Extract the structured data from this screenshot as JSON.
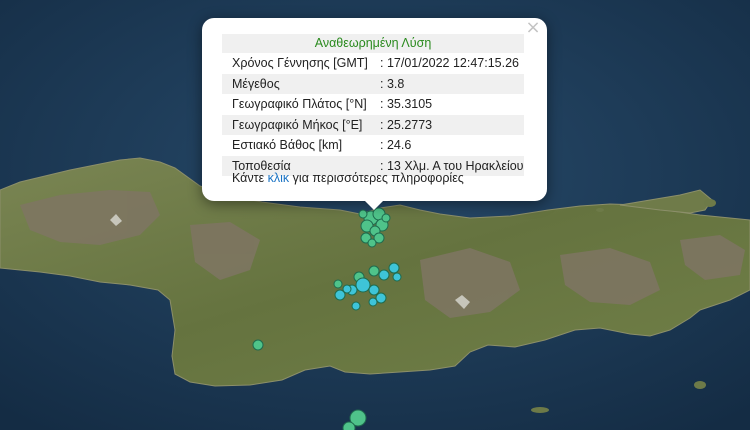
{
  "map": {
    "colors": {
      "sea": "#1a3550",
      "land": "#6d7a48",
      "mountain": "#7d7260",
      "quake_green": "#4fc38a",
      "quake_cyan": "#3ec4d8"
    }
  },
  "popup": {
    "title": "Αναθεωρημένη Λύση",
    "close_icon": "close-icon",
    "rows": [
      {
        "label": "Χρόνος Γέννησης [GMT]",
        "value": ": 17/01/2022 12:47:15.26"
      },
      {
        "label": "Μέγεθος",
        "value": ": 3.8"
      },
      {
        "label": "Γεωγραφικό Πλάτος [°N]",
        "value": ": 35.3105"
      },
      {
        "label": "Γεωγραφικό Μήκος [°E]",
        "value": ": 25.2773"
      },
      {
        "label": "Εστιακό Βάθος [km]",
        "value": ": 24.6"
      },
      {
        "label": "Τοποθεσία",
        "value": ": 13 Χλμ. Α του Ηρακλείου"
      }
    ],
    "more_prefix": "Κάντε ",
    "more_link": "κλικ",
    "more_suffix": " για περισσότερες πληροφορίες"
  }
}
